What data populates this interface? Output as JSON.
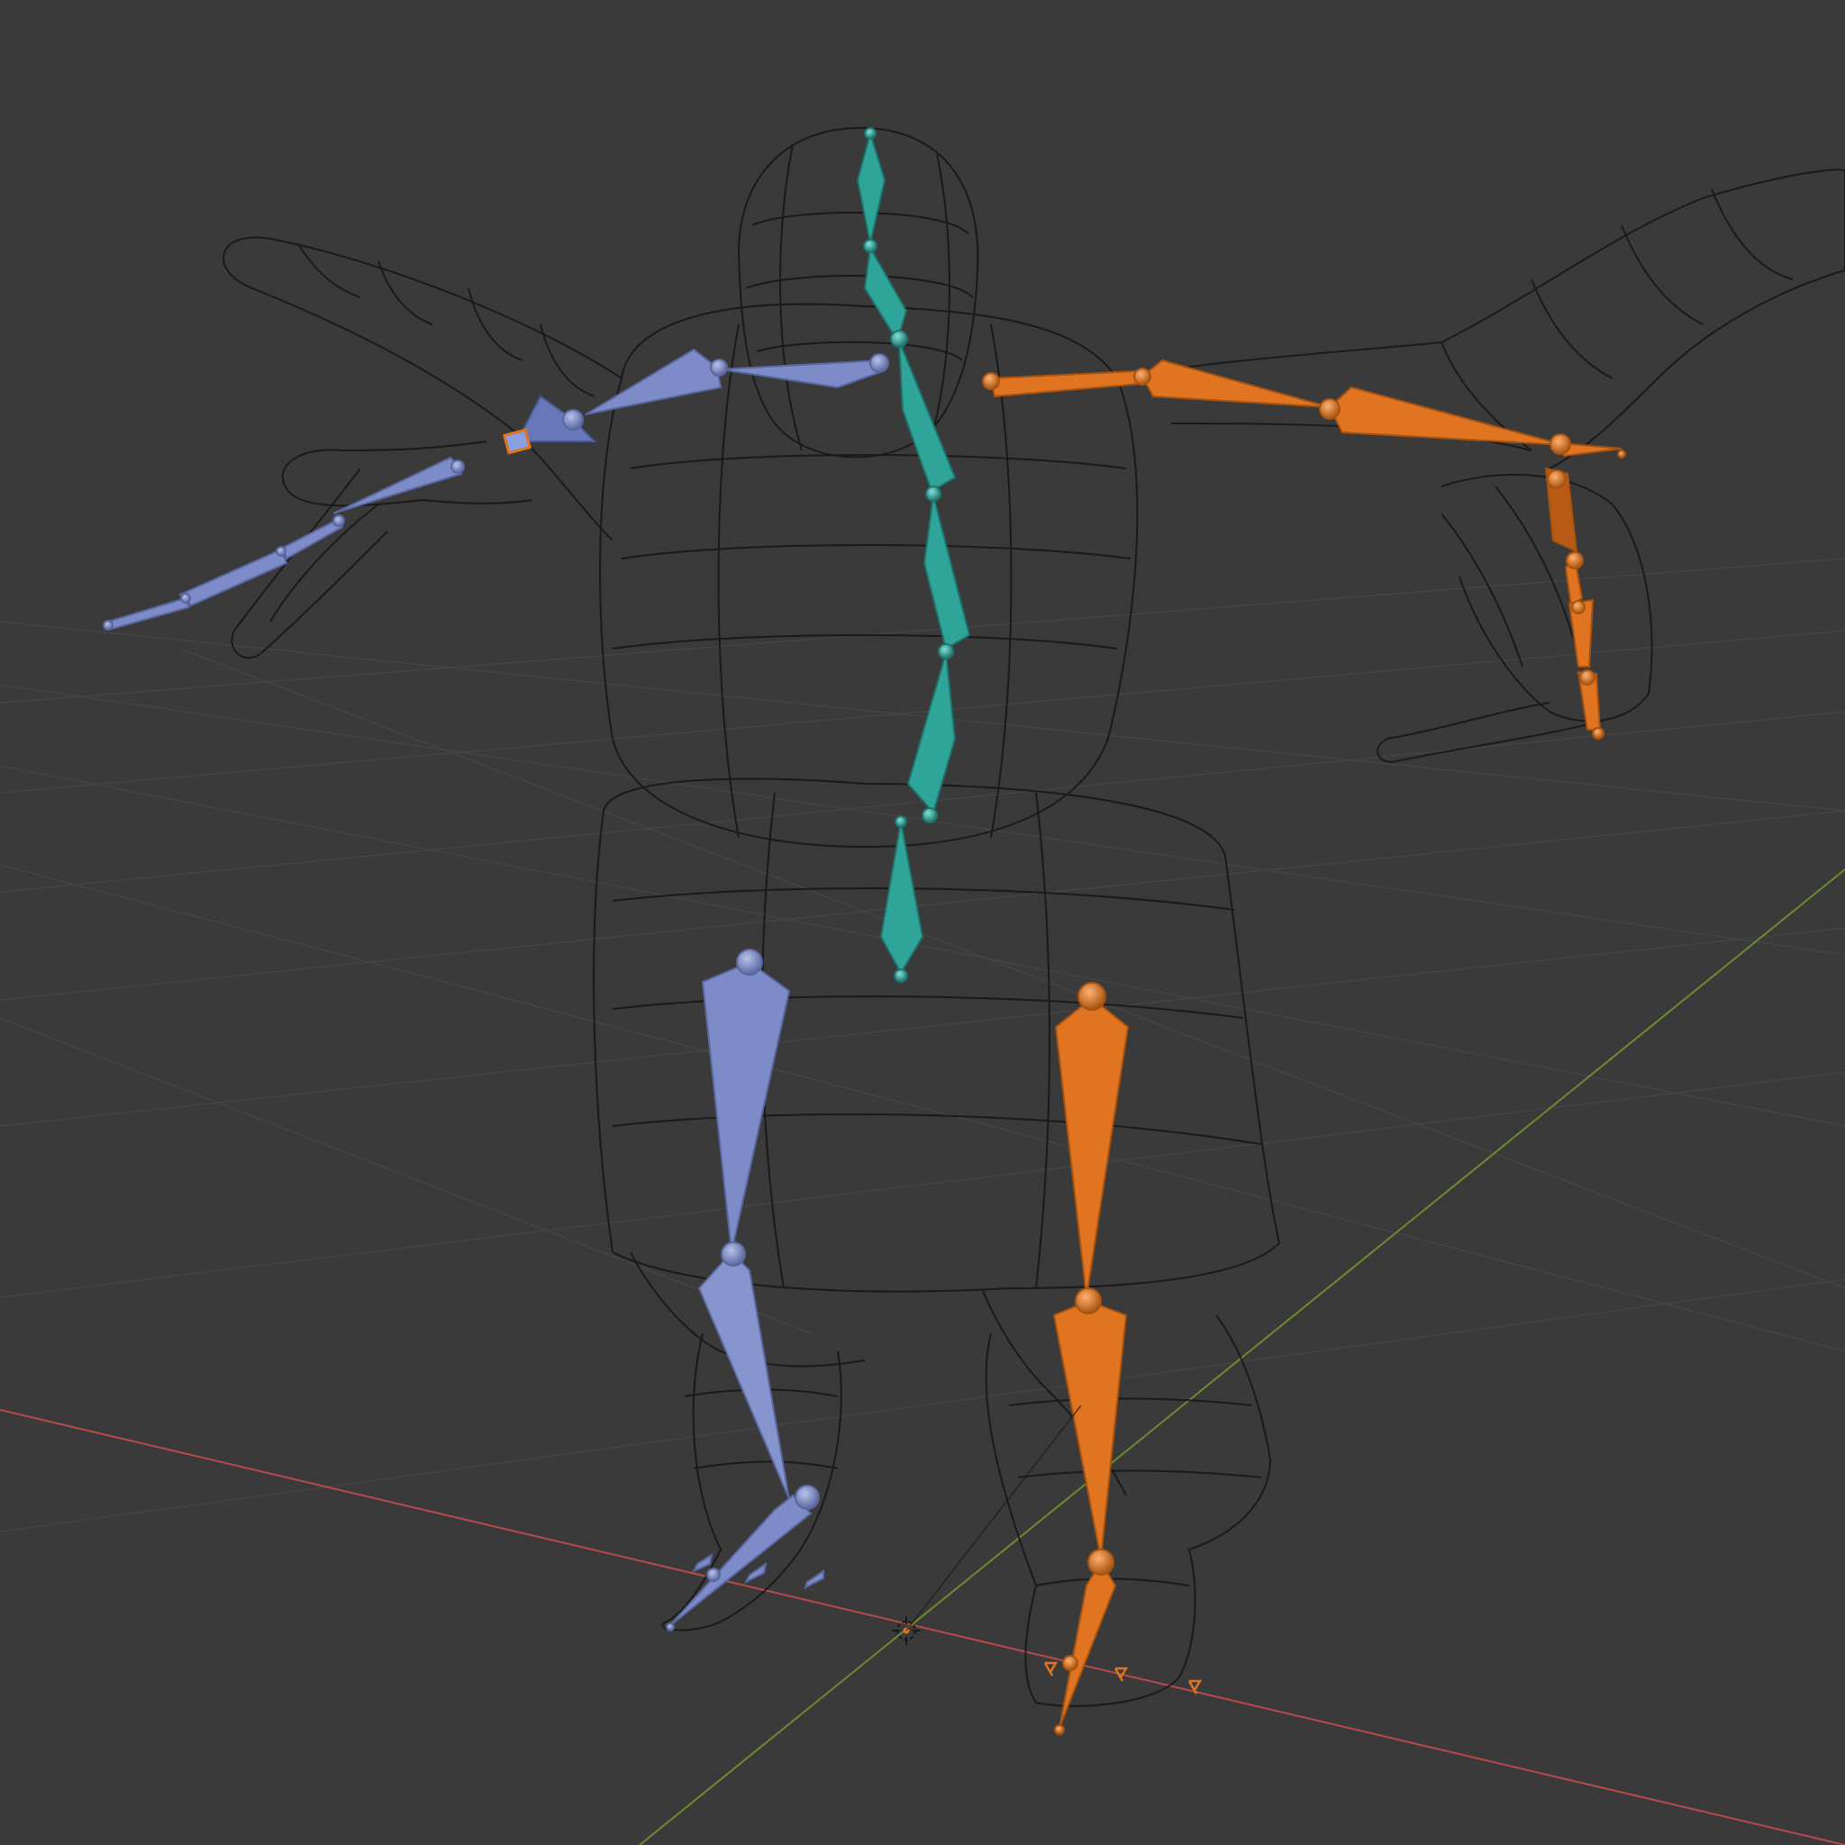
{
  "viewport": {
    "background": "#3a3a3a",
    "grid_color": "#464646",
    "x_axis_color": "#b84a4a",
    "y_axis_color": "#6f8a2e",
    "mesh_color": "#111111"
  },
  "bone_groups": [
    {
      "id": "spine",
      "color": "#2fa59a",
      "color_dark": "#1e746c"
    },
    {
      "id": "left",
      "color": "#7d8cc8",
      "color_dark": "#5a679e"
    },
    {
      "id": "right",
      "color": "#e07420",
      "color_dark": "#a8530f"
    }
  ],
  "icons": {
    "origin": "origin-cursor-icon",
    "empty": "empty-marker-icon"
  }
}
